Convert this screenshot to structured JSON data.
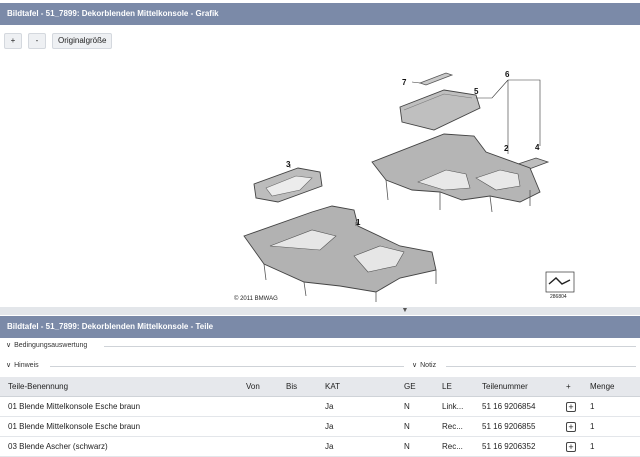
{
  "graphic_panel": {
    "title": "Bildtafel - 51_7899: Dekorblenden Mittelkonsole - Grafik"
  },
  "toolbar": {
    "zoom_in": "+",
    "zoom_out": "-",
    "original_size": "Originalgröße"
  },
  "diagram": {
    "callouts": [
      "7",
      "6",
      "5",
      "2",
      "4",
      "3",
      "1"
    ],
    "copyright": "© 2011 BMWAG",
    "image_number": "286804"
  },
  "parts_panel": {
    "title": "Bildtafel - 51_7899: Dekorblenden Mittelkonsole - Teile",
    "bedingung_label": "Bedingungsauswertung",
    "hinweis_label": "Hinweis",
    "notiz_label": "Notiz"
  },
  "table": {
    "columns": [
      "Teile-Benennung",
      "Von",
      "Bis",
      "KAT",
      "GE",
      "LE",
      "Teilenummer",
      "+",
      "Menge"
    ],
    "rows": [
      {
        "name": "01 Blende Mittelkonsole Esche braun",
        "von": "",
        "bis": "",
        "kat": "Ja",
        "ge": "N",
        "le": "Link...",
        "part_number": "51 16 9206854",
        "add": "+",
        "qty": "1"
      },
      {
        "name": "01 Blende Mittelkonsole Esche braun",
        "von": "",
        "bis": "",
        "kat": "Ja",
        "ge": "N",
        "le": "Rec...",
        "part_number": "51 16 9206855",
        "add": "+",
        "qty": "1"
      },
      {
        "name": "03 Blende Ascher (schwarz)",
        "von": "",
        "bis": "",
        "kat": "Ja",
        "ge": "N",
        "le": "Rec...",
        "part_number": "51 16 9206352",
        "add": "+",
        "qty": "1"
      }
    ]
  }
}
